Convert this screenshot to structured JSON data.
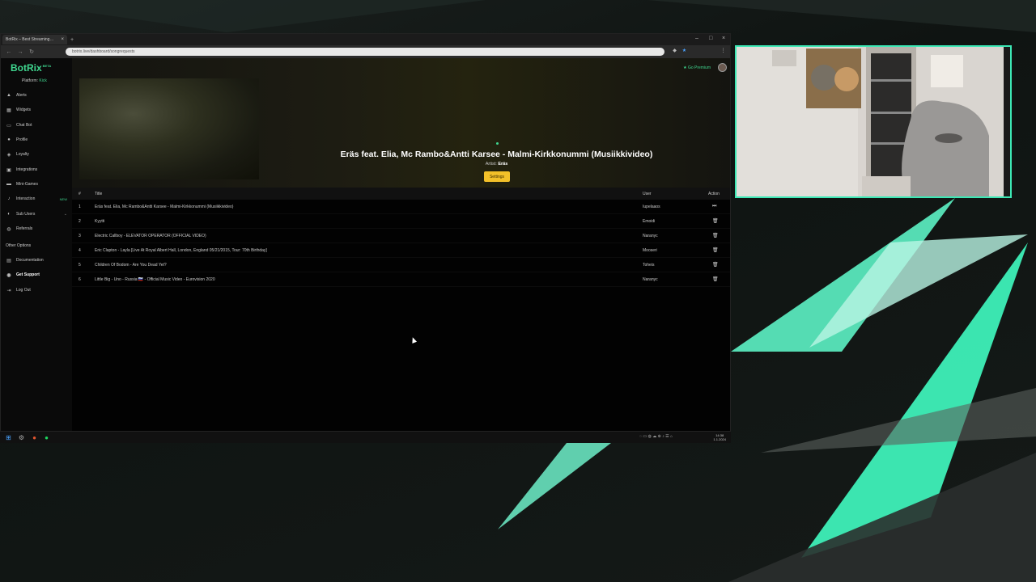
{
  "browser": {
    "tab_title": "BotRix – Best Streaming…",
    "url": "botrix.live/dashboard/songrequests"
  },
  "app": {
    "logo": "BotRix",
    "logo_badge": "BETA",
    "platform_label": "Platform:",
    "platform_value": "Kick",
    "go_premium": "Go Premium"
  },
  "sidebar": {
    "items": [
      {
        "label": "Alerts",
        "icon": "bell-icon"
      },
      {
        "label": "Widgets",
        "icon": "grid-icon"
      },
      {
        "label": "Chat Bot",
        "icon": "chat-icon"
      },
      {
        "label": "Profile",
        "icon": "user-icon"
      },
      {
        "label": "Loyalty",
        "icon": "gift-icon"
      },
      {
        "label": "Integrations",
        "icon": "plug-icon"
      },
      {
        "label": "Mini-Games",
        "icon": "gamepad-icon"
      },
      {
        "label": "Interaction",
        "icon": "music-icon",
        "badge": "NEW"
      },
      {
        "label": "Sub Users",
        "icon": "users-icon"
      },
      {
        "label": "Referrals",
        "icon": "handshake-icon"
      }
    ],
    "other_options_heading": "Other Options",
    "other_items": [
      {
        "label": "Documentation",
        "icon": "book-icon"
      },
      {
        "label": "Get Support",
        "icon": "support-icon"
      },
      {
        "label": "Log Out",
        "icon": "logout-icon"
      }
    ]
  },
  "now_playing": {
    "title": "Eräs feat. Elia, Mc Rambo&Antti Karsee - Malmi-Kirkkonummi (Musiikkivideo)",
    "artist_label": "Artist:",
    "artist": "Eräs",
    "settings_label": "Settings"
  },
  "queue": {
    "headers": {
      "num": "#",
      "title": "Title",
      "user": "User",
      "action": "Action"
    },
    "rows": [
      {
        "num": "1",
        "title": "Eräs feat. Elia, Mc Rambo&Antti Karsee - Malmi-Kirkkonummi (Musiikkivideo)",
        "user": "Iupelaaos",
        "action": "⏭"
      },
      {
        "num": "2",
        "title": "Kyytti",
        "user": "Emoidi",
        "action": "🗑"
      },
      {
        "num": "3",
        "title": "Electric Callboy - ELEVATOR OPERATOR (OFFICIAL VIDEO)",
        "user": "Naranyc",
        "action": "🗑"
      },
      {
        "num": "4",
        "title": "Eric Clapton - Layla [Live At Royal Albert Hall, London, England 05/21/2015, Tour: 70th Birthday]",
        "user": "Mooseri",
        "action": "🗑"
      },
      {
        "num": "5",
        "title": "Children Of Bodom - Are You Dead Yet?",
        "user": "Toheis",
        "action": "🗑"
      },
      {
        "num": "6",
        "title": "Little Big - Uno - Russia 🇷🇺 - Official Music Video - Eurovision 2020",
        "user": "Naranyc",
        "action": "🗑"
      }
    ]
  },
  "taskbar": {
    "time": "14:38",
    "date": "1.1.2024"
  },
  "colors": {
    "accent": "#3fd68f",
    "settings_button": "#f2c029",
    "webcam_border": "#3de8b5"
  }
}
